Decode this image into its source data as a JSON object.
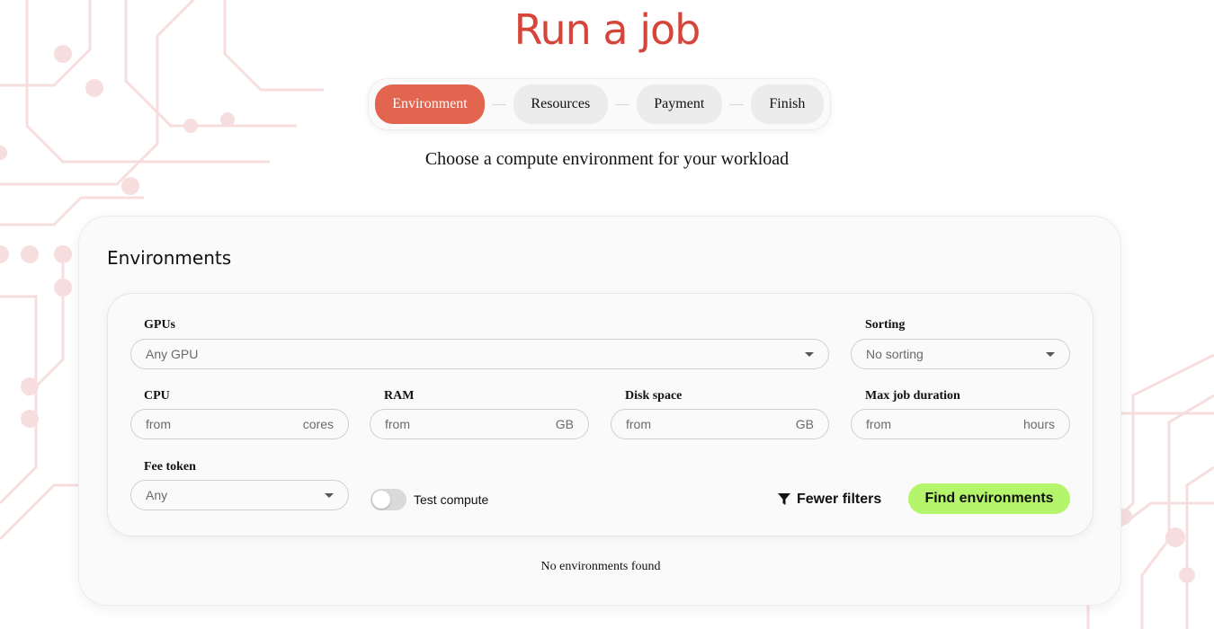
{
  "page": {
    "title": "Run a job",
    "subtitle": "Choose a compute environment for your workload"
  },
  "stepper": {
    "steps": [
      {
        "label": "Environment",
        "active": true
      },
      {
        "label": "Resources",
        "active": false
      },
      {
        "label": "Payment",
        "active": false
      },
      {
        "label": "Finish",
        "active": false
      }
    ]
  },
  "environments": {
    "title": "Environments",
    "filters": {
      "gpus": {
        "label": "GPUs",
        "placeholder": "Any GPU"
      },
      "sorting": {
        "label": "Sorting",
        "placeholder": "No sorting"
      },
      "cpu": {
        "label": "CPU",
        "placeholder": "from",
        "unit": "cores"
      },
      "ram": {
        "label": "RAM",
        "placeholder": "from",
        "unit": "GB"
      },
      "disk": {
        "label": "Disk space",
        "placeholder": "from",
        "unit": "GB"
      },
      "duration": {
        "label": "Max job duration",
        "placeholder": "from",
        "unit": "hours"
      },
      "fee_token": {
        "label": "Fee token",
        "placeholder": "Any"
      },
      "test_compute": {
        "label": "Test compute",
        "enabled": false
      }
    },
    "buttons": {
      "fewer_filters": "Fewer filters",
      "find": "Find environments"
    },
    "empty_message": "No environments found"
  },
  "colors": {
    "title": "#d6453a",
    "step_active": "#e2654f",
    "find_button": "#b5f56b",
    "circuit": "#f6d6d6"
  },
  "icons": {
    "filter": "filter-funnel-icon",
    "dropdown": "chevron-down-icon"
  }
}
